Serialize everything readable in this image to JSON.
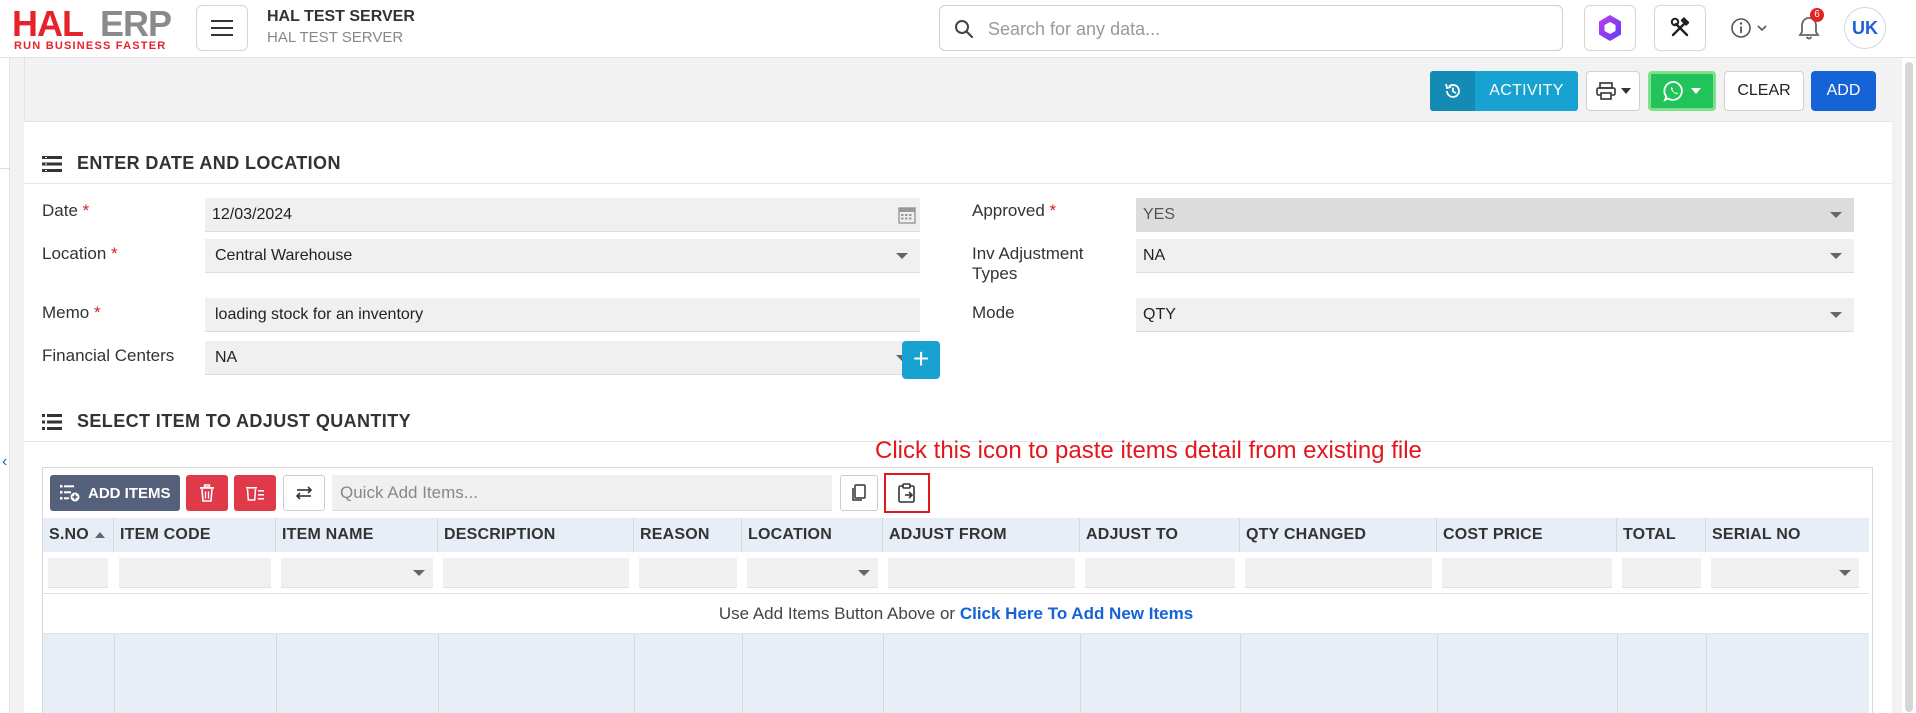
{
  "header": {
    "logo_main": "HAL",
    "logo_sub": "ERP",
    "logo_tagline": "RUN BUSINESS FASTER",
    "server_title": "HAL TEST SERVER",
    "server_subtitle": "HAL TEST SERVER",
    "search_placeholder": "Search for any data...",
    "notification_count": "6",
    "user_initials": "UK"
  },
  "actions": {
    "activity": "ACTIVITY",
    "clear": "CLEAR",
    "add": "ADD"
  },
  "section1": {
    "title": "ENTER DATE AND LOCATION",
    "required_mark": "*",
    "date_label": "Date",
    "date_value": "12/03/2024",
    "location_label": "Location",
    "location_value": "Central Warehouse",
    "memo_label": "Memo",
    "memo_value": "loading stock for an inventory",
    "fin_label": "Financial Centers",
    "fin_value": "NA",
    "approved_label": "Approved",
    "approved_value": "YES",
    "inv_label_line1": "Inv Adjustment",
    "inv_label_line2": "Types",
    "inv_value": "NA",
    "mode_label": "Mode",
    "mode_value": "QTY"
  },
  "section2": {
    "title": "SELECT ITEM TO ADJUST QUANTITY",
    "annotation": "Click this icon to paste items detail from existing file",
    "add_items": "ADD ITEMS",
    "quick_add_placeholder": "Quick Add Items...",
    "columns": [
      "S.NO",
      "ITEM CODE",
      "ITEM NAME",
      "DESCRIPTION",
      "REASON",
      "LOCATION",
      "ADJUST FROM",
      "ADJUST TO",
      "QTY CHANGED",
      "COST PRICE",
      "TOTAL",
      "SERIAL NO"
    ],
    "empty_text": "Use Add Items Button Above or",
    "empty_link": "Click Here To Add New Items"
  },
  "colors": {
    "brand_red": "#e5232a",
    "primary_blue": "#1563d6",
    "info_cyan": "#17a2d1",
    "danger": "#e0394a",
    "whatsapp": "#22c35a",
    "annotation_red": "#e3151d"
  }
}
